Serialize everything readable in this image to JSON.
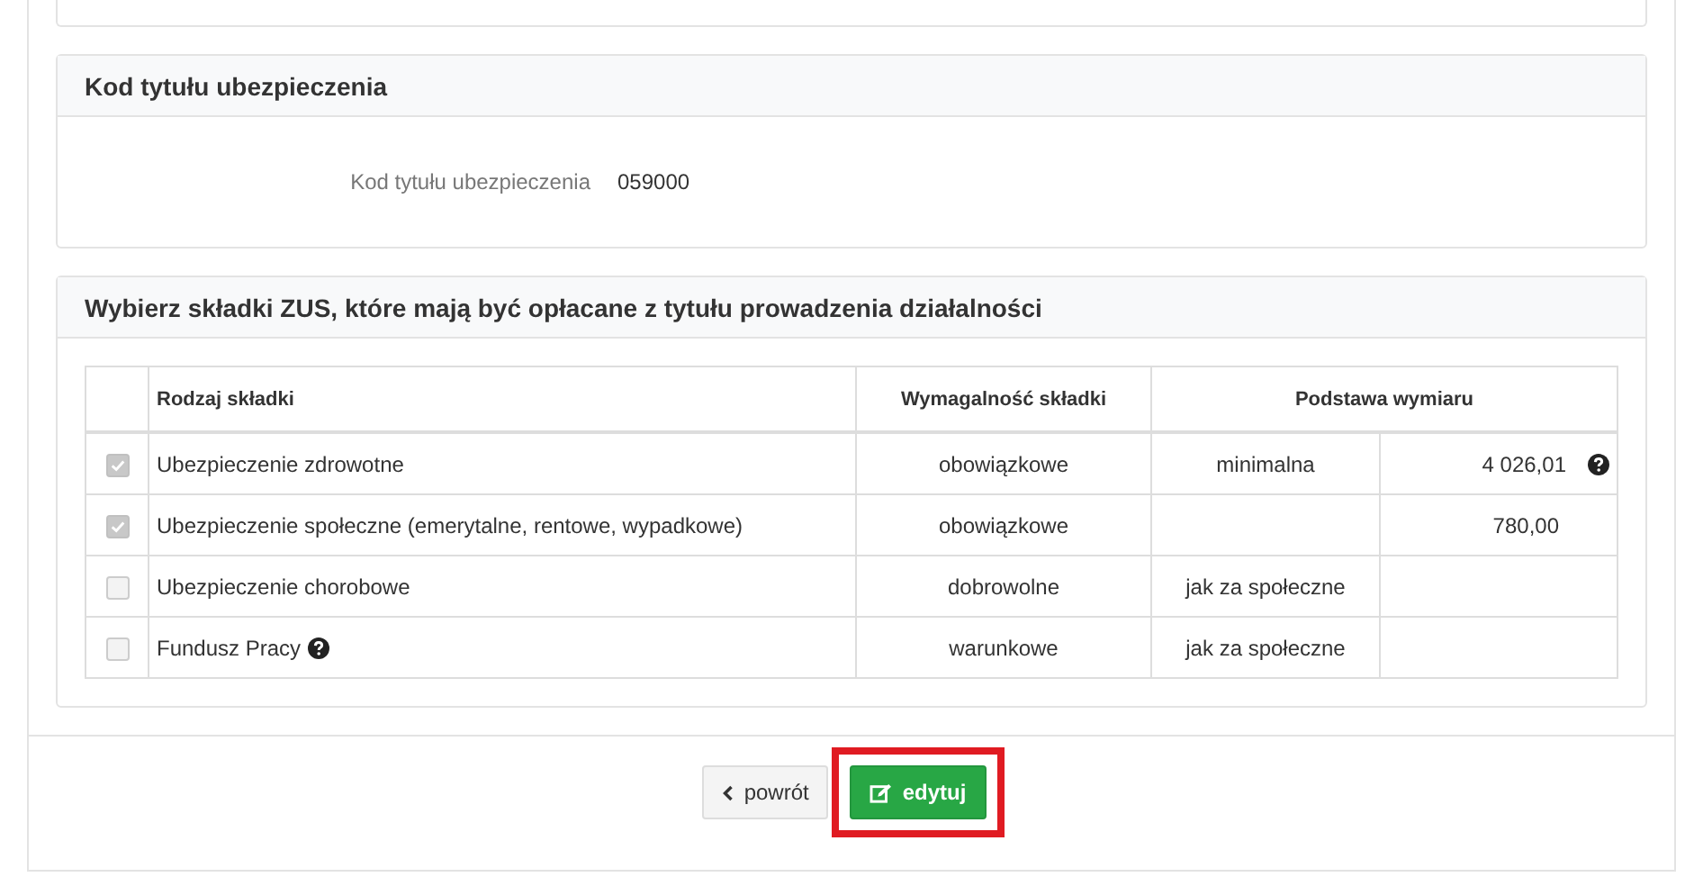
{
  "code_panel": {
    "title": "Kod tytułu ubezpieczenia",
    "label": "Kod tytułu ubezpieczenia",
    "value": "059000"
  },
  "contributions_panel": {
    "title": "Wybierz składki ZUS, które mają być opłacane z tytułu prowadzenia działalności",
    "columns": [
      "Rodzaj składki",
      "Wymagalność składki",
      "Podstawa wymiaru"
    ],
    "rows": [
      {
        "checked": true,
        "name": "Ubezpieczenie zdrowotne",
        "help": false,
        "requirement": "obowiązkowe",
        "basis": "minimalna",
        "amount": "4 026,01",
        "amount_help": true
      },
      {
        "checked": true,
        "name": "Ubezpieczenie społeczne (emerytalne, rentowe, wypadkowe)",
        "help": false,
        "requirement": "obowiązkowe",
        "amount": "780,00",
        "amount_help": false
      },
      {
        "checked": false,
        "name": "Ubezpieczenie chorobowe",
        "help": false,
        "requirement": "dobrowolne",
        "basis": "jak za społeczne",
        "amount_help": false
      },
      {
        "checked": false,
        "name": "Fundusz Pracy",
        "help": true,
        "requirement": "warunkowe",
        "basis": "jak za społeczne",
        "amount_help": false
      }
    ]
  },
  "buttons": [
    {
      "label": "powrót",
      "kind": "back",
      "highlighted": false
    },
    {
      "label": "edytuj",
      "kind": "edit",
      "highlighted": true
    }
  ]
}
